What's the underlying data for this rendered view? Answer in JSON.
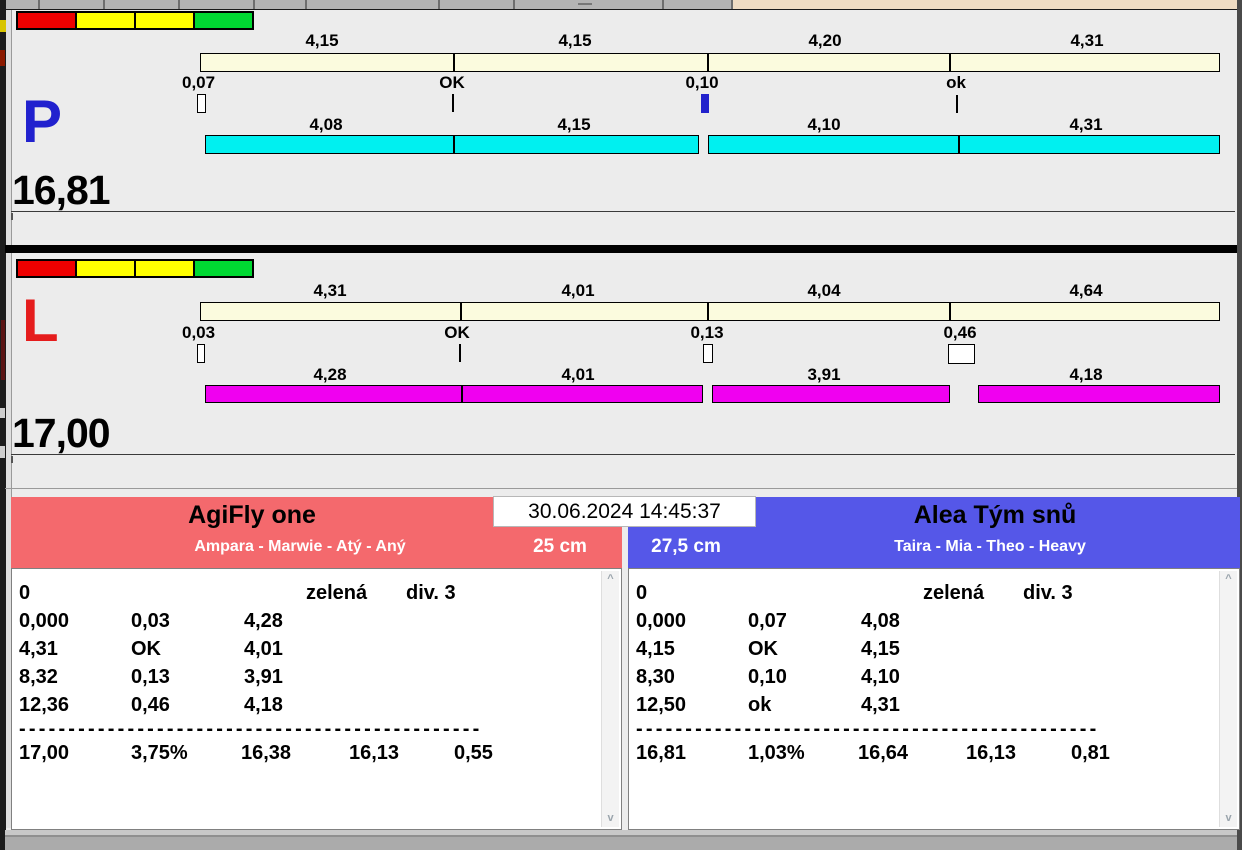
{
  "datetime": "30.06.2024 14:45:37",
  "colors": {
    "traffic_swatches": [
      "#EE0000",
      "#FFFF00",
      "#FFFF00",
      "#00D832"
    ],
    "reference_bar": "#FBFBDE",
    "panel_p_run_bar": "#00F0F0",
    "panel_l_run_bar": "#F000F0",
    "letter_p": "#2121CE",
    "letter_l": "#E51C1C",
    "team_left_header": "#F4696D",
    "team_right_header": "#5557E8"
  },
  "panel_p": {
    "letter": "P",
    "total": "16,81",
    "top_segments": [
      "4,15",
      "4,15",
      "4,20",
      "4,31"
    ],
    "splits": [
      "0,07",
      "OK",
      "0,10",
      "ok"
    ],
    "markers": [
      "white-box",
      "tick",
      "blue-box",
      "tick"
    ],
    "bottom_segments": [
      "4,08",
      "4,15",
      "4,10",
      "4,31"
    ]
  },
  "panel_l": {
    "letter": "L",
    "total": "17,00",
    "top_segments": [
      "4,31",
      "4,01",
      "4,04",
      "4,64"
    ],
    "splits": [
      "0,03",
      "OK",
      "0,13",
      "0,46"
    ],
    "markers": [
      "white-box",
      "tick",
      "white-box",
      "white-box-wide"
    ],
    "bottom_segments": [
      "4,28",
      "4,01",
      "3,91",
      "4,18"
    ]
  },
  "team_left": {
    "name": "AgiFly one",
    "members": "Ampara - Marwie - Atý - Aný",
    "jump_height": "25 cm",
    "table": {
      "header_row": [
        "0",
        "zelená",
        "div. 3"
      ],
      "rows": [
        [
          "0,000",
          "0,03",
          "4,28"
        ],
        [
          "4,31",
          "OK",
          "4,01"
        ],
        [
          "8,32",
          "0,13",
          "3,91"
        ],
        [
          "12,36",
          "0,46",
          "4,18"
        ]
      ],
      "separator": "-----------------------------------------------",
      "totals": [
        "17,00",
        "3,75%",
        "16,38",
        "16,13",
        "0,55"
      ]
    }
  },
  "team_right": {
    "name": "Alea Tým snů",
    "members": "Taira - Mia - Theo - Heavy",
    "jump_height": "27,5 cm",
    "table": {
      "header_row": [
        "0",
        "zelená",
        "div. 3"
      ],
      "rows": [
        [
          "0,000",
          "0,07",
          "4,08"
        ],
        [
          "4,15",
          "OK",
          "4,15"
        ],
        [
          "8,30",
          "0,10",
          "4,10"
        ],
        [
          "12,50",
          "ok",
          "4,31"
        ]
      ],
      "separator": "-----------------------------------------------",
      "totals": [
        "16,81",
        "1,03%",
        "16,64",
        "16,13",
        "0,81"
      ]
    }
  },
  "scrollbar": {
    "up": "^",
    "dn": "v"
  }
}
